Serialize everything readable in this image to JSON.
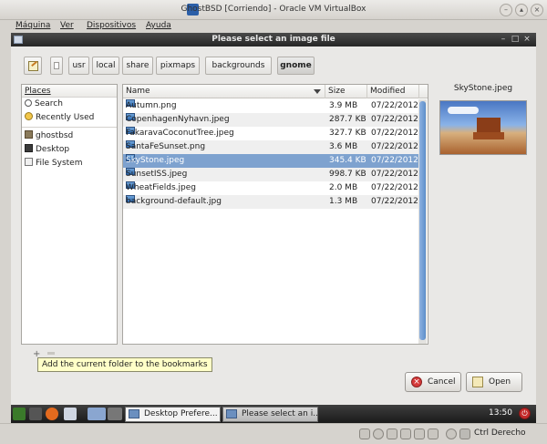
{
  "vbox": {
    "title": "GhostBSD [Corriendo] - Oracle VM VirtualBox",
    "menu": [
      "Máquina",
      "Ver",
      "Dispositivos",
      "Ayuda"
    ],
    "host_key": "Ctrl Derecho"
  },
  "dialog": {
    "title": "Please select an image file",
    "path_buttons": [
      "usr",
      "local",
      "share",
      "pixmaps",
      "backgrounds",
      "gnome"
    ],
    "active_path": "gnome",
    "places_header": "Places",
    "places": [
      {
        "label": "Search",
        "icon": "search-icon"
      },
      {
        "label": "Recently Used",
        "icon": "recent-icon"
      },
      {
        "label": "ghostbsd",
        "icon": "home-folder-icon"
      },
      {
        "label": "Desktop",
        "icon": "desktop-icon"
      },
      {
        "label": "File System",
        "icon": "drive-icon"
      }
    ],
    "columns": {
      "name": "Name",
      "size": "Size",
      "modified": "Modified"
    },
    "files": [
      {
        "name": "Autumn.png",
        "size": "3.9 MB",
        "modified": "07/22/2012"
      },
      {
        "name": "CopenhagenNyhavn.jpeg",
        "size": "287.7 KB",
        "modified": "07/22/2012"
      },
      {
        "name": "FakaravaCoconutTree.jpeg",
        "size": "327.7 KB",
        "modified": "07/22/2012"
      },
      {
        "name": "SantaFeSunset.png",
        "size": "3.6 MB",
        "modified": "07/22/2012"
      },
      {
        "name": "SkyStone.jpeg",
        "size": "345.4 KB",
        "modified": "07/22/2012"
      },
      {
        "name": "SunsetISS.jpeg",
        "size": "998.7 KB",
        "modified": "07/22/2012"
      },
      {
        "name": "WheatFields.jpeg",
        "size": "2.0 MB",
        "modified": "07/22/2012"
      },
      {
        "name": "background-default.jpg",
        "size": "1.3 MB",
        "modified": "07/22/2012"
      }
    ],
    "selected_file": "SkyStone.jpeg",
    "preview_name": "SkyStone.jpeg",
    "tooltip": "Add the current folder to the bookmarks",
    "cancel_label": "Cancel",
    "open_label": "Open"
  },
  "taskbar": {
    "tasks": [
      "Desktop Prefere...",
      "Please select an i..."
    ],
    "clock": "13:50"
  },
  "colors": {
    "selection": "#7ea2cf",
    "title_bar": "#2e2e2e",
    "tooltip_bg": "#ffffc8"
  }
}
